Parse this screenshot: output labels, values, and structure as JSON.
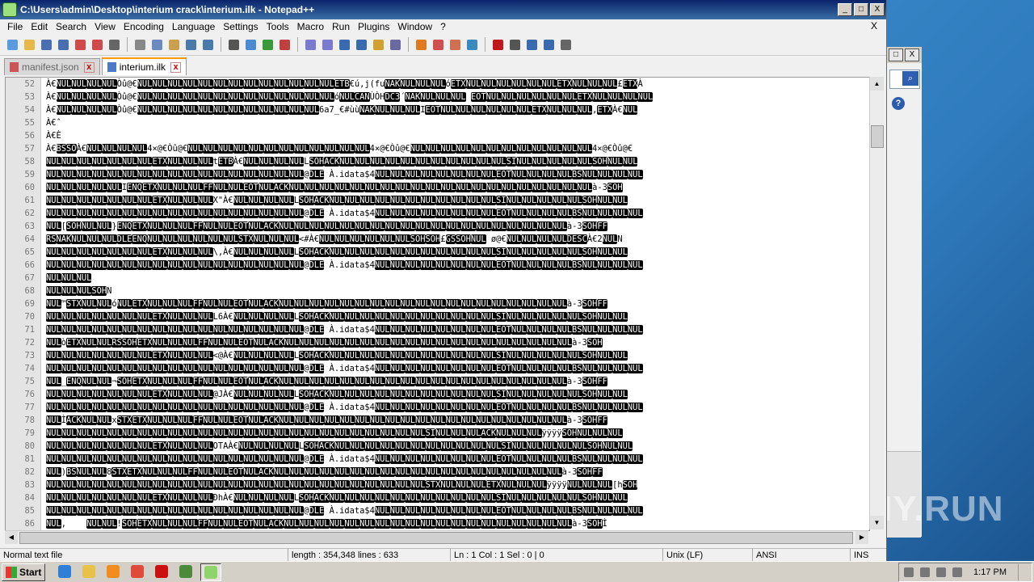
{
  "window": {
    "title": "C:\\Users\\admin\\Desktop\\interium crack\\interium.ilk - Notepad++",
    "minimize_glyph": "_",
    "maximize_glyph": "□",
    "close_glyph": "X"
  },
  "menu": [
    "File",
    "Edit",
    "Search",
    "View",
    "Encoding",
    "Language",
    "Settings",
    "Tools",
    "Macro",
    "Run",
    "Plugins",
    "Window",
    "?"
  ],
  "menu_close": "X",
  "toolbar_icons": [
    "new-icon",
    "open-icon",
    "save-icon",
    "save-all-icon",
    "close-icon",
    "close-all-icon",
    "print-icon",
    "cut-icon",
    "copy-icon",
    "paste-icon",
    "undo-icon",
    "redo-icon",
    "find-icon",
    "replace-icon",
    "zoom-in-icon",
    "zoom-out-icon",
    "sync-v-icon",
    "sync-h-icon",
    "wrap-icon",
    "show-all-chars-icon",
    "indent-guide-icon",
    "udl-icon",
    "doc-map-icon",
    "function-list-icon",
    "folder-as-workspace-icon",
    "monitor-icon",
    "record-macro-icon",
    "stop-record-icon",
    "play-macro-icon",
    "run-macro-multiple-icon",
    "save-macro-icon"
  ],
  "tabs": [
    {
      "label": "manifest.json",
      "active": false
    },
    {
      "label": "interium.ilk",
      "active": true
    }
  ],
  "editor": {
    "lines": [
      {
        "n": "52",
        "t": "À€NULNULNULNULÒû@€NULNULNULNULNULNULNULNULNULNULNULNULNULETB€ú,j(fuNAKNULNULNULóETXNULNULNULNULNULNULETXNULNULNUL£ETXÀ"
      },
      {
        "n": "53",
        "t": "À€NULNULNULNULÒû@€NULNULNULNULNULNULNULNULNULNULNULNULNULóNULCANÙÒHDC3´NAKNULNULNUL EOTNULNULNULNULNULNULETXNULNULNULNUL"
      },
      {
        "n": "54",
        "t": "À€NULNULNULNULÒû@€NULNULNULNULNULNULNULNULNULNULNULNUL6a7_€#ùùNAKNULNULNULIEOTNULNULNULNULNULNULETXNULNULNUL,ETXÀ€NUL"
      },
      {
        "n": "55",
        "t": "À€ˆ"
      },
      {
        "n": "56",
        "t": "À€È"
      },
      {
        "n": "57",
        "t": "À€BSSOÀ€NULNULNULNUL4×@€Òû@€NULNULNULNULNULNULNULNULNULNULNULNUL4×@€Òû@€NULNULNULNULNULNULNULNULNULNULNULNUL4×@€Òû@€"
      },
      {
        "n": "58",
        "t": "NULNULNULNULNULNULNULETXNULNULNULtETBÀ€NULNULNULNULLSOHACKNULNULNULNULNULNULNULNULNULNULNULSINULNULNULNULNULSOHNULNUL"
      },
      {
        "n": "59",
        "t": "NULNULNULNULNULNULNULNULNULNULNULNULNULNULNULNULNUL@DLE À.idata$4NULNULNULNULNULNULNULNULEOTNULNULNULNULBSNULNULNULNUL"
      },
      {
        "n": "60",
        "t": "NULNULNULNULNULIENQETXNULNULNULFFNULNULEOTNULACKNULNULNULNULNULNULNULNULNULNULNULNULNULNULNULNULNULNULNULNULà-3SOH"
      },
      {
        "n": "61",
        "t": "NULNULNULNULNULNULNULETXNULNULNULX\"À€NULNULNULNULLSOHACKNULNULNULNULNULNULNULNULNULNULNULSINULNULNULNULNULSOHNULNUL"
      },
      {
        "n": "62",
        "t": "NULNULNULNULNULNULNULNULNULNULNULNULNULNULNULNULNUL@DLE À.idata$4NULNULNULNULNULNULNULNULEOTNULNULNULNULBSNULNULNULNUL"
      },
      {
        "n": "63",
        "t": "NUL[SOHNULNUL}ENQETXNULNULNULFFNULNULEOTNULACKNULNULNULNULNULNULNULNULNULNULNULNULNULNULNULNULNULNULNULà-3SOHFF"
      },
      {
        "n": "64",
        "t": "RSNAKNULNULNULDLEENQNULNULNULNULNULNULSTXNULNULNUL<#À€NULNULNULNULNULNULSOHSOH£GSSOHNUL ø@€NULNULNULNULDESCÀ€2NULN"
      },
      {
        "n": "65",
        "t": "NULNULNULNULNULNULNULETXNULNULNUL\\,À€NULNULNULNULLSOHACKNULNULNULNULNULNULNULNULNULNULNULSINULNULNULNULNULSOHNULNUL"
      },
      {
        "n": "66",
        "t": "NULNULNULNULNULNULNULNULNULNULNULNULNULNULNULNULNUL@DLE À.idata$4NULNULNULNULNULNULNULNULEOTNULNULNULNULBSNULNULNULNUL"
      },
      {
        "n": "67",
        "t": "NULNULNUL"
      },
      {
        "n": "68",
        "t": "NULNULNULSOHN"
      },
      {
        "n": "69",
        "t": "NUL™STXNULNULóNULETXNULNULNULFFNULNULEOTNULACKNULNULNULNULNULNULNULNULNULNULNULNULNULNULNULNULNULNULNULà-3SOHFF"
      },
      {
        "n": "70",
        "t": "NULNULNULNULNULNULNULETXNULNULNULL6À€NULNULNULNULLSOHACKNULNULNULNULNULNULNULNULNULNULNULSINULNULNULNULNULSOHNULNUL"
      },
      {
        "n": "71",
        "t": "NULNULNULNULNULNULNULNULNULNULNULNULNULNULNULNULNUL@DLE À.idata$4NULNULNULNULNULNULNULNULEOTNULNULNULNULBSNULNULNULNUL"
      },
      {
        "n": "72",
        "t": "NULòETXNULNULRSSOHETXNULNULNULFFNULNULEOTNULACKNULNULNULNULNULNULNULNULNULNULNULNULNULNULNULNULNULNULNULà-3SOH"
      },
      {
        "n": "73",
        "t": "NULNULNULNULNULNULNULETXNULNULNUL<@À€NULNULNULNULLSOHACKNULNULNULNULNULNULNULNULNULNULNULSINULNULNULNULNULSOHNULNUL"
      },
      {
        "n": "74",
        "t": "NULNULNULNULNULNULNULNULNULNULNULNULNULNULNULNULNUL@DLE À.idata$4NULNULNULNULNULNULNULNULEOTNULNULNULNULBSNULNULNULNUL"
      },
      {
        "n": "75",
        "t": "NUL_ENQNULNUL¬SOHETXNULNULNULFFNULNULEOTNULACKNULNULNULNULNULNULNULNULNULNULNULNULNULNULNULNULNULNULNULà-3SOHFF"
      },
      {
        "n": "76",
        "t": "NULNULNULNULNULNULNULETXNULNULNUL@JÀ€NULNULNULNULLSOHACKNULNULNULNULNULNULNULNULNULNULNULSINULNULNULNULNULSOHNULNUL"
      },
      {
        "n": "77",
        "t": "NULNULNULNULNULNULNULNULNULNULNULNULNULNULNULNULNUL@DLE À.idata$4NULNULNULNULNULNULNULNULEOTNULNULNULNULBSNULNULNULNUL"
      },
      {
        "n": "78",
        "t": "NULÌACKNULNULxSTXETXNULNULNULFFNULNULEOTNULACKNULNULNULNULNULNULNULNULNULNULNULNULNULNULNULNULNULNULNULà-3SOHFF"
      },
      {
        "n": "79",
        "t": "NULNULNULNULNULNULNULNULNULNULNULNULNULNULNULNULNULNULNULNULNULNULNULNULNULSINULNULNULACKNULNULNULÿÿÿÿSOHNULNULNUL"
      },
      {
        "n": "80",
        "t": "NULNULNULNULNULNULNULETXNULNULNULOTAÀ€NULNULNULNULLSOHACKNULNULNULNULNULNULNULNULNULNULNULSINULNULNULNULNULSOHNULNUL"
      },
      {
        "n": "81",
        "t": "NULNULNULNULNULNULNULNULNULNULNULNULNULNULNULNULNUL@DLE À.idata$4NULNULNULNULNULNULNULNULEOTNULNULNULNULBSNULNULNULNUL"
      },
      {
        "n": "82",
        "t": "NUL)BSNULNUL8STXETXNULNULNULFFNULNULEOTNULACKNULNULNULNULNULNULNULNULNULNULNULNULNULNULNULNULNULNULNULà-3SOHFF"
      },
      {
        "n": "83",
        "t": "NULNULNULNULNULNULNULNULNULNULNULNULNULNULNULNULNULNULNULNULNULNULNULNULNULSTXNULNULNULETXNULNULNULÿÿÿÿNULNULNUL[hSOH"
      },
      {
        "n": "84",
        "t": "NULNULNULNULNULNULNULETXNULNULNULÐhÀ€NULNULNULNULLSOHACKNULNULNULNULNULNULNULNULNULNULNULSINULNULNULNULNULSOHNULNUL"
      },
      {
        "n": "85",
        "t": "NULNULNULNULNULNULNULNULNULNULNULNULNULNULNULNULNUL@DLE À.idata$4NULNULNULNULNULNULNULNULEOTNULNULNULNULBSNULNULNULNUL"
      },
      {
        "n": "86",
        "t": "NUL,    NULNUL!SOHETXNULNULNULFFNULNULEOTNULACKNULNULNULNULNULNULNULNULNULNULNULNULNULNULNULNULNULNULNULà-3SOHÌ"
      }
    ]
  },
  "status": {
    "type": "Normal text file",
    "length": "length : 354,348    lines : 633",
    "position": "Ln : 1    Col : 1    Sel : 0 | 0",
    "eol": "Unix (LF)",
    "encoding": "ANSI",
    "mode": "INS"
  },
  "taskbar": {
    "start_label": "Start",
    "clock": "1:17 PM",
    "apps": [
      {
        "name": "ie-icon",
        "color": "#2f7fd6"
      },
      {
        "name": "explorer-icon",
        "color": "#e8c14a"
      },
      {
        "name": "media-player-icon",
        "color": "#f28c1e"
      },
      {
        "name": "chrome-icon",
        "color": "#e04a3a"
      },
      {
        "name": "opera-icon",
        "color": "#cc1010"
      },
      {
        "name": "tool-icon",
        "color": "#4a8a3a"
      },
      {
        "name": "notepadpp-icon",
        "color": "#8fd46a"
      }
    ]
  },
  "watermark": "ANY.RUN",
  "colors": {
    "title_bar": "#0a246a",
    "control_block": "#000000",
    "tab_active_accent": "#ff9900"
  }
}
